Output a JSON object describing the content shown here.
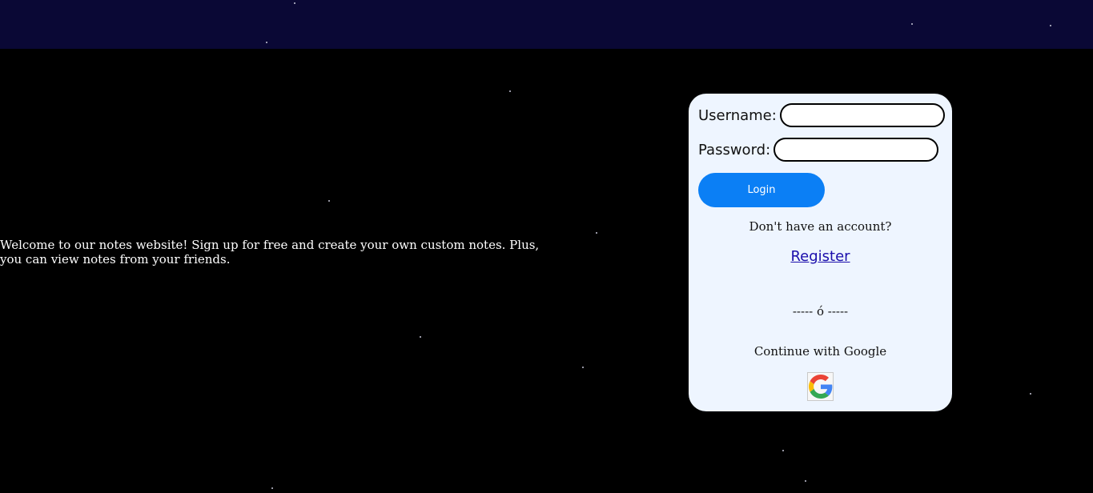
{
  "intro": {
    "text": "Welcome to our notes website! Sign up for free and create your own custom notes. Plus, you can view notes from your friends."
  },
  "login_form": {
    "username_label": "Username:",
    "username_value": "",
    "password_label": "Password:",
    "password_value": "",
    "login_button_label": "Login",
    "no_account_text": "Don't have an account?",
    "register_link_text": "Register",
    "divider_text": "----- ó -----",
    "continue_google_text": "Continue with Google",
    "google_icon": "google-logo-icon"
  },
  "colors": {
    "background": "#000000",
    "top_bar": "#0a0835",
    "card_background": "#eef5ff",
    "login_button": "#0b7ff5",
    "link": "#1a0dab"
  }
}
